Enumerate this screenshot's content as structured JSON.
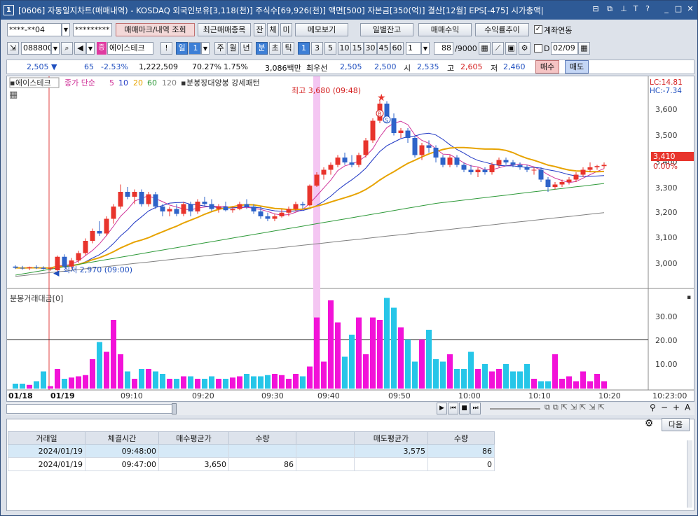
{
  "window": {
    "num": "1",
    "title": "[0606] 자동일지차트(매매내역) - KOSDAQ 외국인보유[3,118(천)] 주식수[69,926(천)] 액면[500] 자본금[350(억)] 결산[12월] EPS[-475] 시가총액|",
    "controls": [
      "⊟",
      "⧉",
      "📌",
      "T",
      "?",
      "_",
      "□",
      "✕"
    ]
  },
  "toolbar1": {
    "account": "****-**04",
    "password": "*********",
    "btn_trade_mark": "매매마크/내역 조회",
    "btn_recent": "최근매매종목",
    "tab_jan": "잔",
    "tab_che": "체",
    "tab_mi": "미",
    "btn_memo": "메모보기",
    "btn_daily": "일별잔고",
    "btn_profit": "매매수익",
    "btn_return": "수익률추이",
    "chk_link": "계좌연동"
  },
  "toolbar2": {
    "code": "088800",
    "search_icon": "search-icon",
    "sound_icon": "speaker-icon",
    "cert_badge": "증",
    "stock_name": "에이스테크",
    "excl": "!",
    "period_il": "일",
    "period_num": "1",
    "period_labels": [
      "주",
      "월",
      "년"
    ],
    "minute_tabs": [
      "분",
      "초",
      "틱"
    ],
    "intervals": [
      "1",
      "3",
      "5",
      "10",
      "15",
      "30",
      "45",
      "60"
    ],
    "interval_sel": "1",
    "count": "88",
    "count_max": "/9000",
    "chk_d": "D",
    "date": "02/09"
  },
  "quote": {
    "price": "2,505",
    "arrow": "▼",
    "change": "65",
    "pct": "-2.53%",
    "volume": "1,222,509",
    "ratio": "70.27%",
    "turnover": "1.75%",
    "amount": "3,086백만",
    "bid_label": "최우선",
    "bid1": "2,505",
    "bid2": "2,500",
    "open_label": "시",
    "open": "2,535",
    "high_label": "고",
    "high": "2,605",
    "low_label": "저",
    "low": "2,460",
    "buy_btn": "매수",
    "sell_btn": "매도"
  },
  "chart": {
    "legend_name": "에이스테크",
    "legend_close": "종가 단순",
    "ma": [
      "5",
      "10",
      "20",
      "60",
      "120"
    ],
    "ma_colors": [
      "#d0359a",
      "#1f37c4",
      "#e7a300",
      "#2f9a3a",
      "#808080"
    ],
    "pattern": "분봉장대양봉 강세패턴",
    "max_label": "최고 3,680 (09:48)",
    "min_label": "최저 2,970 (09:00)",
    "lc": "LC:14.81",
    "hc": "HC:-7.34",
    "price_axis": [
      "3,600",
      "3,500",
      "3,400",
      "3,300",
      "3,200",
      "3,100",
      "3,000"
    ],
    "cur_price": "3,410",
    "cur_pct": "0.00%",
    "vol_title": "분봉거래대금[0]",
    "vol_axis": [
      "30.00",
      "20.00",
      "10.00"
    ],
    "dates": [
      "01/18",
      "01/19"
    ],
    "time_labels": [
      "09:10",
      "09:20",
      "09:30",
      "09:40",
      "09:50",
      "10:00",
      "10:10",
      "10:20"
    ],
    "time_right": "10:23:00",
    "buy_marker": "B",
    "sell_marker": "S",
    "up_color": "#e8342c",
    "down_color": "#2e63c9",
    "vol_up_color": "#f212d8",
    "vol_down_color": "#26c6e8"
  },
  "chart_data": {
    "type": "candlestick",
    "x_label": "time",
    "ylim": [
      2920,
      3720
    ],
    "candles": [
      [
        2995,
        3000,
        2985,
        2990
      ],
      [
        2990,
        2998,
        2982,
        2988
      ],
      [
        2988,
        2995,
        2980,
        2992
      ],
      [
        2992,
        3000,
        2985,
        2990
      ],
      [
        2990,
        2996,
        2982,
        2986
      ],
      [
        2986,
        2992,
        2978,
        2990
      ],
      [
        2980,
        3040,
        2970,
        3035
      ],
      [
        3035,
        3045,
        2990,
        2995
      ],
      [
        2995,
        3030,
        2985,
        3020
      ],
      [
        3020,
        3060,
        3010,
        3050
      ],
      [
        3050,
        3110,
        3040,
        3100
      ],
      [
        3100,
        3150,
        3090,
        3140
      ],
      [
        3140,
        3180,
        3120,
        3130
      ],
      [
        3130,
        3200,
        3120,
        3190
      ],
      [
        3190,
        3250,
        3170,
        3240
      ],
      [
        3240,
        3330,
        3230,
        3300
      ],
      [
        3300,
        3320,
        3270,
        3280
      ],
      [
        3280,
        3310,
        3250,
        3300
      ],
      [
        3300,
        3310,
        3240,
        3250
      ],
      [
        3250,
        3300,
        3240,
        3290
      ],
      [
        3290,
        3300,
        3230,
        3240
      ],
      [
        3240,
        3250,
        3200,
        3220
      ],
      [
        3220,
        3240,
        3200,
        3230
      ],
      [
        3230,
        3250,
        3200,
        3210
      ],
      [
        3210,
        3260,
        3200,
        3250
      ],
      [
        3250,
        3260,
        3200,
        3220
      ],
      [
        3220,
        3270,
        3210,
        3260
      ],
      [
        3260,
        3280,
        3240,
        3250
      ],
      [
        3250,
        3270,
        3220,
        3230
      ],
      [
        3230,
        3250,
        3215,
        3240
      ],
      [
        3240,
        3260,
        3220,
        3225
      ],
      [
        3225,
        3240,
        3215,
        3230
      ],
      [
        3230,
        3260,
        3225,
        3250
      ],
      [
        3250,
        3270,
        3230,
        3240
      ],
      [
        3240,
        3250,
        3210,
        3220
      ],
      [
        3220,
        3240,
        3190,
        3200
      ],
      [
        3200,
        3215,
        3180,
        3190
      ],
      [
        3190,
        3210,
        3180,
        3200
      ],
      [
        3200,
        3230,
        3195,
        3215
      ],
      [
        3215,
        3240,
        3200,
        3230
      ],
      [
        3230,
        3260,
        3220,
        3250
      ],
      [
        3250,
        3260,
        3230,
        3245
      ],
      [
        3245,
        3330,
        3240,
        3325
      ],
      [
        3325,
        3380,
        3320,
        3370
      ],
      [
        3370,
        3400,
        3350,
        3390
      ],
      [
        3390,
        3420,
        3370,
        3410
      ],
      [
        3410,
        3450,
        3400,
        3440
      ],
      [
        3440,
        3460,
        3410,
        3420
      ],
      [
        3420,
        3450,
        3400,
        3410
      ],
      [
        3410,
        3460,
        3400,
        3450
      ],
      [
        3450,
        3520,
        3440,
        3510
      ],
      [
        3510,
        3600,
        3500,
        3590
      ],
      [
        3590,
        3680,
        3580,
        3660
      ],
      [
        3660,
        3670,
        3580,
        3600
      ],
      [
        3600,
        3620,
        3530,
        3540
      ],
      [
        3540,
        3560,
        3520,
        3550
      ],
      [
        3550,
        3560,
        3500,
        3520
      ],
      [
        3520,
        3530,
        3440,
        3450
      ],
      [
        3450,
        3500,
        3430,
        3490
      ],
      [
        3490,
        3510,
        3460,
        3480
      ],
      [
        3480,
        3490,
        3420,
        3440
      ],
      [
        3440,
        3450,
        3400,
        3410
      ],
      [
        3410,
        3450,
        3400,
        3440
      ],
      [
        3440,
        3450,
        3400,
        3410
      ],
      [
        3410,
        3420,
        3380,
        3390
      ],
      [
        3390,
        3410,
        3370,
        3380
      ],
      [
        3380,
        3400,
        3360,
        3390
      ],
      [
        3390,
        3400,
        3370,
        3380
      ],
      [
        3380,
        3420,
        3370,
        3410
      ],
      [
        3410,
        3440,
        3400,
        3430
      ],
      [
        3430,
        3440,
        3410,
        3420
      ],
      [
        3420,
        3430,
        3400,
        3410
      ],
      [
        3410,
        3420,
        3390,
        3400
      ],
      [
        3400,
        3410,
        3380,
        3390
      ],
      [
        3390,
        3400,
        3370,
        3390
      ],
      [
        3390,
        3400,
        3340,
        3350
      ],
      [
        3350,
        3360,
        3300,
        3320
      ],
      [
        3320,
        3340,
        3310,
        3330
      ],
      [
        3330,
        3350,
        3320,
        3340
      ],
      [
        3340,
        3360,
        3330,
        3350
      ],
      [
        3350,
        3380,
        3340,
        3370
      ],
      [
        3370,
        3400,
        3360,
        3390
      ],
      [
        3390,
        3420,
        3380,
        3400
      ],
      [
        3400,
        3410,
        3390,
        3405
      ],
      [
        3405,
        3420,
        3395,
        3410
      ]
    ],
    "volume": [
      2,
      2,
      1.5,
      3,
      7,
      1,
      8,
      4,
      4.5,
      5,
      5.5,
      12,
      19,
      15,
      28,
      14,
      7,
      4,
      8,
      8,
      7,
      6,
      4,
      4,
      5,
      5,
      4,
      4,
      5,
      4,
      4,
      4.5,
      5,
      6,
      5,
      5,
      5.5,
      6,
      5.5,
      4,
      6,
      5,
      9,
      29,
      11,
      36,
      27,
      13,
      22,
      29,
      14,
      29,
      28,
      37,
      33,
      25,
      20,
      11,
      20,
      24,
      12,
      11,
      14,
      8,
      8,
      15,
      8,
      10,
      7,
      8,
      10,
      7,
      7,
      10,
      4,
      3,
      3,
      14,
      4,
      5,
      3,
      7,
      3,
      6,
      3
    ],
    "ma5": "from closes",
    "ma10": "from closes",
    "ma20": "from closes",
    "ma60": "from closes",
    "ma120": "from closes"
  },
  "scroll": {
    "nav": [
      "▶",
      "⏮",
      "■",
      "⏭"
    ],
    "zoom_icons": [
      "⚲",
      "−",
      "+",
      "A"
    ]
  },
  "lower": {
    "btn_next": "다음",
    "headers": [
      "거래일",
      "체결시간",
      "매수평균가",
      "수량",
      "",
      "매도평균가",
      "수량"
    ],
    "rows": [
      [
        "2024/01/19",
        "09:48:00",
        "",
        "",
        "",
        "3,575",
        "86"
      ],
      [
        "2024/01/19",
        "09:47:00",
        "3,650",
        "86",
        "",
        "",
        "0"
      ]
    ]
  }
}
